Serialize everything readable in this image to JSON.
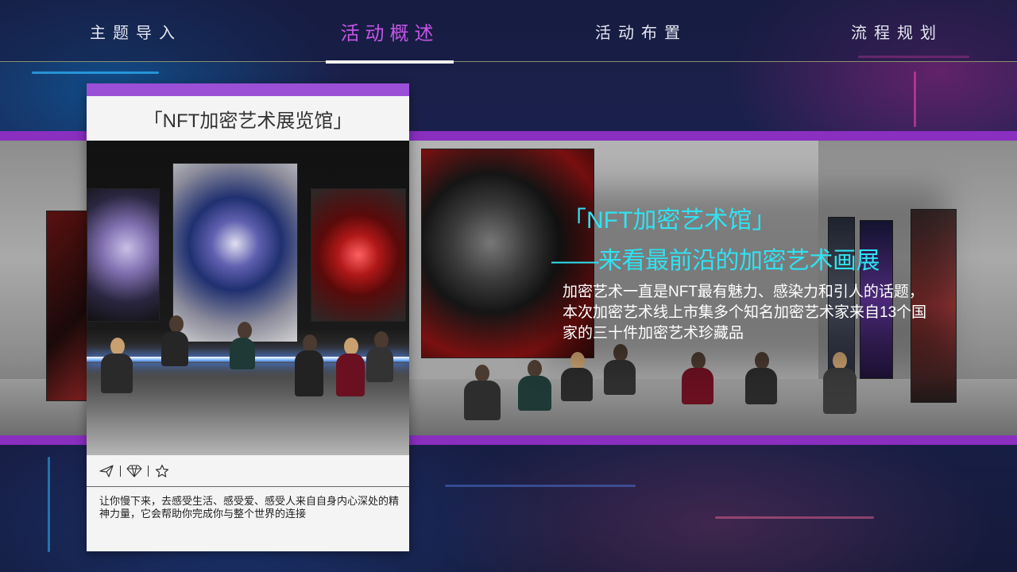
{
  "nav": {
    "items": [
      {
        "label": "主题导入"
      },
      {
        "label": "活动概述"
      },
      {
        "label": "活动布置"
      },
      {
        "label": "流程规划"
      }
    ],
    "active_index": 1
  },
  "colors": {
    "accent_purple": "#8a2fbf",
    "active_nav": "#c455e6",
    "hero_cyan": "#30e2f2"
  },
  "card": {
    "title": "「NFT加密艺术展览馆」",
    "icons": [
      "send-icon",
      "diamond-icon",
      "star-icon"
    ],
    "description": "让你慢下来，去感受生活、感受爱、感受人来自自身内心深处的精神力量，它会帮助你完成你与整个世界的连接"
  },
  "hero": {
    "title": "「NFT加密艺术馆」",
    "subtitle": "——来看最前沿的加密艺术画展",
    "description": "加密艺术一直是NFT最有魅力、感染力和引人的话题，本次加密艺术线上市集多个知名加密艺术家来自13个国家的三十件加密艺术珍藏品"
  }
}
